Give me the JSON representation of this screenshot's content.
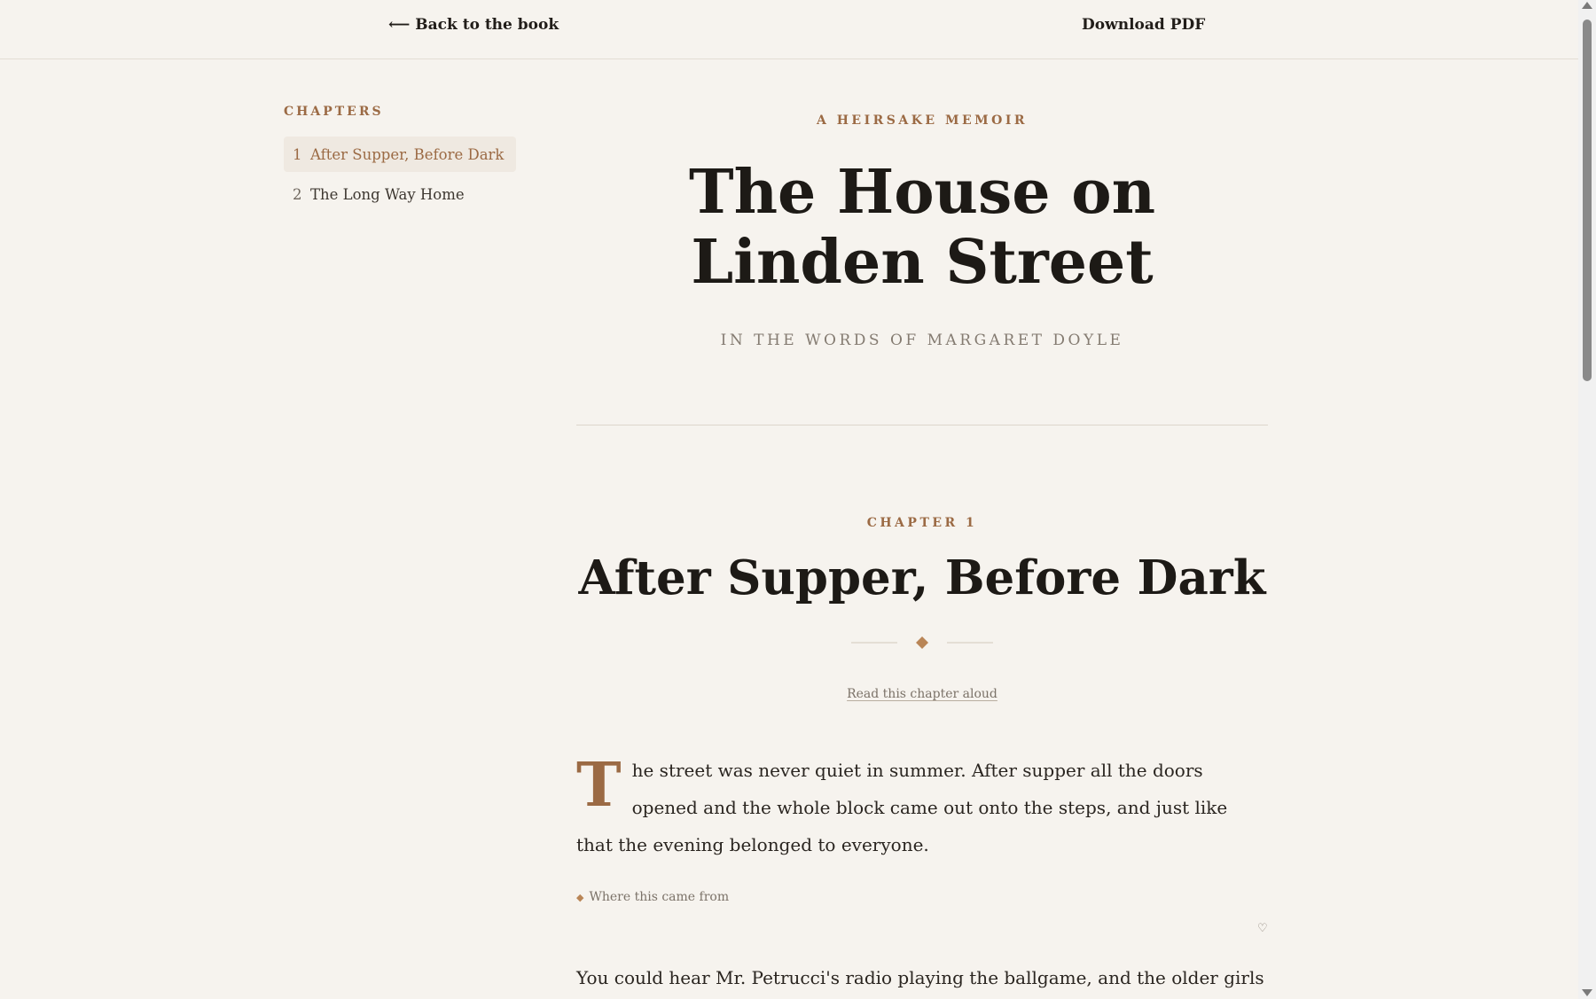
{
  "header": {
    "back_label": "⟵ Back to the book",
    "download_label": "Download PDF"
  },
  "sidebar": {
    "heading": "CHAPTERS",
    "items": [
      {
        "num": "1",
        "label": "After Supper, Before Dark",
        "active": true
      },
      {
        "num": "2",
        "label": "The Long Way Home",
        "active": false
      }
    ]
  },
  "book": {
    "eyebrow": "A HEIRSAKE MEMOIR",
    "title_line1": "The House on",
    "title_line2": "Linden Street",
    "byline": "IN THE WORDS OF MARGARET DOYLE"
  },
  "chapter": {
    "eyebrow": "CHAPTER 1",
    "title": "After Supper, Before Dark",
    "read_aloud": "Read this chapter aloud",
    "dropcap": "T",
    "para1_rest": "he street was never quiet in summer. After supper all the doors opened and the whole block came out onto the steps, and just like that the evening belonged to everyone.",
    "source_label": "Where this came from",
    "heart_icon": "♡",
    "para2": "You could hear Mr. Petrucci's radio playing the ballgame, and the older girls"
  },
  "colors": {
    "accent": "#9b6a44",
    "background": "#f6f3ee",
    "text": "#1f1b17"
  }
}
